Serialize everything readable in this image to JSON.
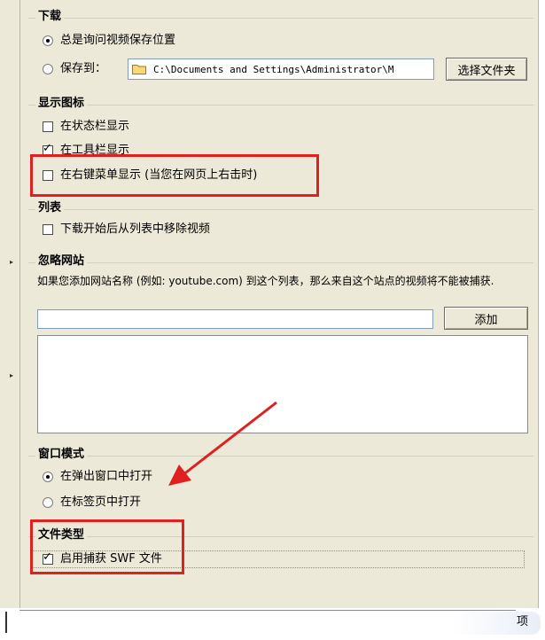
{
  "download": {
    "title": "下载",
    "ask_label": "总是询问视频保存位置",
    "ask_selected": true,
    "save_to_label": "保存到：",
    "save_to_selected": false,
    "save_path": "C:\\Documents and Settings\\Administrator\\M",
    "choose_folder_button": "选择文件夹"
  },
  "show_icon": {
    "title": "显示图标",
    "status_bar_label": "在状态栏显示",
    "status_bar_checked": false,
    "toolbar_label": "在工具栏显示",
    "toolbar_checked": true,
    "context_menu_label": "在右键菜单显示 (当您在网页上右击时)",
    "context_menu_checked": false
  },
  "list": {
    "title": "列表",
    "remove_label": "下载开始后从列表中移除视频",
    "remove_checked": false
  },
  "ignore_sites": {
    "title": "忽略网站",
    "description": "如果您添加网站名称 (例如: youtube.com) 到这个列表，那么来自这个站点的视频将不能被捕获.",
    "input_value": "",
    "add_button": "添加",
    "sites": []
  },
  "window_mode": {
    "title": "窗口模式",
    "popup_label": "在弹出窗口中打开",
    "popup_selected": true,
    "tab_label": "在标签页中打开",
    "tab_selected": false
  },
  "file_types": {
    "title": "文件类型",
    "capture_swf_label": "启用捕获 SWF 文件",
    "capture_swf_checked": true
  },
  "bottom": {
    "partial_text": "项"
  },
  "colors": {
    "highlight": "#e02020",
    "panel": "#ece9d8"
  }
}
